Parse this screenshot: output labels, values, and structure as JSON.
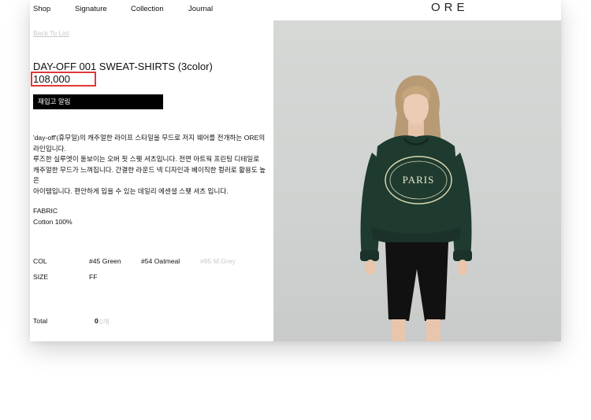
{
  "nav": {
    "items": [
      "Shop",
      "Signature",
      "Collection",
      "Journal"
    ],
    "logo": "ORE"
  },
  "product": {
    "back_label": "Back To List",
    "title": "DAY-OFF 001 SWEAT-SHIRTS (3color)",
    "price": "108,000",
    "restock_label": "재입고 알림",
    "description": [
      "'day-off'(휴무일)의 캐주얼한 라이프 스타일을 무드로 저지 웨어를 전개하는 ORE의",
      "라인입니다.",
      "루즈한 실루엣이 돋보이는 오버 핏 스웻 셔츠입니다. 전면 아트웍 프린팅 디테일로",
      "캐주얼한 무드가 느껴집니다. 간결한 라운드 넥 디자인과 베이직한 컬러로 활용도 높은",
      "아이템입니다. 편안하게 입을 수 있는 데일리 에센셜 스웻 셔츠 입니다."
    ],
    "fabric_label": "FABRIC",
    "fabric_value": "Cotton 100%",
    "color_label": "COL",
    "colors": [
      {
        "label": "#45 Green",
        "available": true
      },
      {
        "label": "#54 Oatmeal",
        "available": true
      },
      {
        "label": "#95 M.Grey",
        "available": false
      }
    ],
    "size_label": "SIZE",
    "sizes": [
      "FF"
    ],
    "total_label": "Total",
    "total_value": "0",
    "total_unit": "0개"
  },
  "image": {
    "print_text": "PARIS",
    "sweater_color": "#1f3b30",
    "shorts_color": "#111111"
  }
}
